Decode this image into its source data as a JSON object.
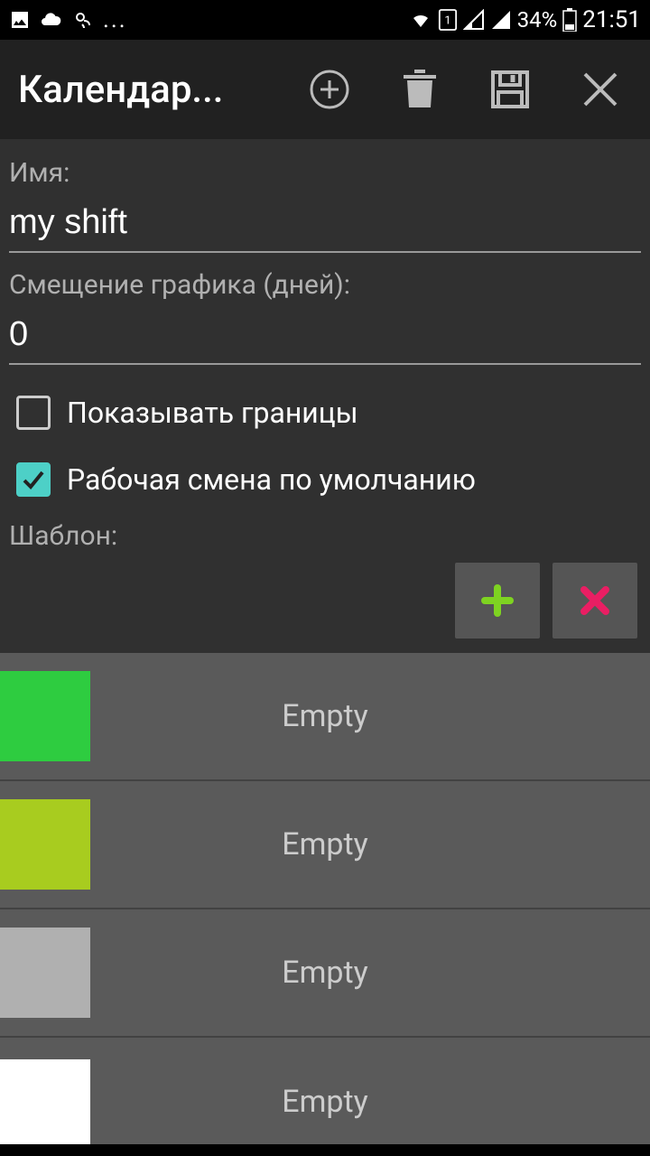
{
  "status": {
    "battery": "34%",
    "time": "21:51"
  },
  "header": {
    "title": "Календар..."
  },
  "form": {
    "name_label": "Имя:",
    "name_value": "my shift",
    "offset_label": "Смещение графика (дней):",
    "offset_value": "0",
    "show_borders_label": "Показывать границы",
    "default_shift_label": "Рабочая смена по умолчанию",
    "pattern_label": "Шаблон:"
  },
  "items": [
    {
      "color": "#2ecc40",
      "label": "Empty"
    },
    {
      "color": "#a8cc1f",
      "label": "Empty"
    },
    {
      "color": "#b0b0b0",
      "label": "Empty"
    },
    {
      "color": "#ffffff",
      "label": "Empty"
    }
  ]
}
